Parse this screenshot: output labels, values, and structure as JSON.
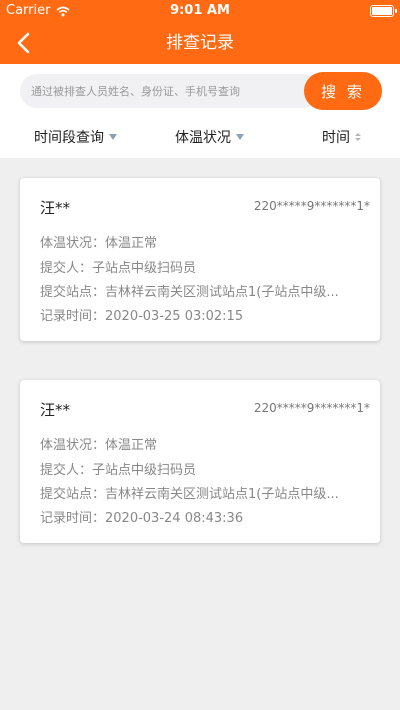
{
  "status_bar": {
    "carrier": "Carrier",
    "time": "9:01 AM"
  },
  "navbar": {
    "title": "排查记录"
  },
  "search": {
    "placeholder": "通过被排查人员姓名、身份证、手机号查询",
    "button_label": "搜 索"
  },
  "filters": [
    {
      "label": "时间段查询"
    },
    {
      "label": "体温状况"
    },
    {
      "label": "时间"
    }
  ],
  "records": [
    {
      "name": "汪**",
      "id_number": "220*****9*******1*",
      "temperature_label": "体温状况：",
      "temperature": "体温正常",
      "submitter_label": "提交人：",
      "submitter": "子站点中级扫码员",
      "station_label": "提交站点：",
      "station": "吉林祥云南关区测试站点1(子站点中级...",
      "time_label": "记录时间：",
      "time": "2020-03-25 03:02:15"
    },
    {
      "name": "汪**",
      "id_number": "220*****9*******1*",
      "temperature_label": "体温状况：",
      "temperature": "体温正常",
      "submitter_label": "提交人：",
      "submitter": "子站点中级扫码员",
      "station_label": "提交站点：",
      "station": "吉林祥云南关区测试站点1(子站点中级...",
      "time_label": "记录时间：",
      "time": "2020-03-24 08:43:36"
    }
  ],
  "colors": {
    "accent": "#ff6a13",
    "background": "#efefef"
  }
}
